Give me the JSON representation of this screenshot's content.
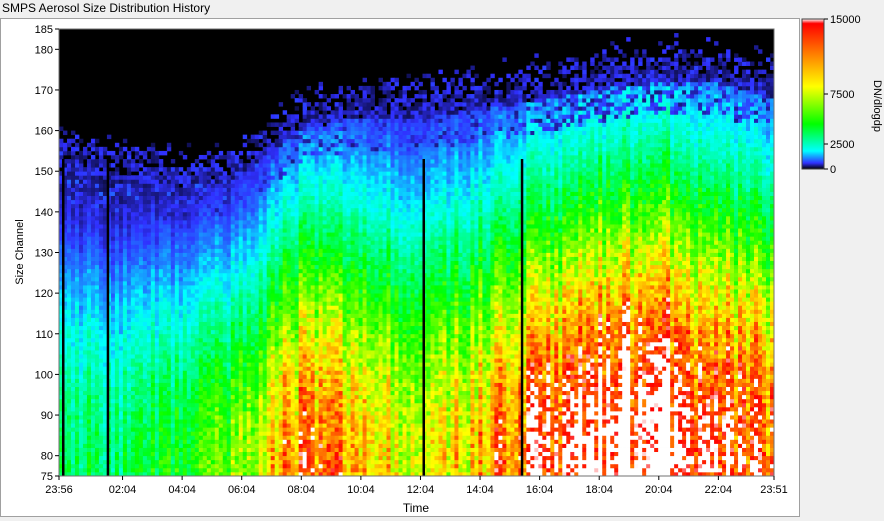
{
  "window": {
    "title": "SMPS Aerosol Size Distribution History"
  },
  "chart_data": {
    "type": "heatmap",
    "title": "",
    "xlabel": "Time",
    "ylabel": "Size Channel",
    "x_ticks": [
      "23:56",
      "02:04",
      "04:04",
      "06:04",
      "08:04",
      "10:04",
      "12:04",
      "14:04",
      "16:04",
      "18:04",
      "20:04",
      "22:04",
      "23:51"
    ],
    "x_range": [
      "23:56",
      "23:51"
    ],
    "y_ticks": [
      75,
      80,
      90,
      100,
      110,
      120,
      130,
      140,
      150,
      160,
      170,
      180,
      185
    ],
    "ylim": [
      75,
      185
    ],
    "colorbar": {
      "label": "DN/dlogdp",
      "ticks": [
        0,
        2500,
        7500,
        15000
      ],
      "range": [
        0,
        15000
      ],
      "colors": [
        "#000000",
        "#3030ff",
        "#00ffff",
        "#00ff00",
        "#ffff00",
        "#ff8800",
        "#ff0000",
        "#ffffff"
      ]
    },
    "gaps_hours": [
      0.1,
      1.6,
      12.2,
      15.5
    ],
    "profile": [
      {
        "hour": 0,
        "peak": 3500,
        "top_channel": 150
      },
      {
        "hour": 2,
        "peak": 3500,
        "top_channel": 148
      },
      {
        "hour": 4,
        "peak": 4500,
        "top_channel": 146
      },
      {
        "hour": 6,
        "peak": 6000,
        "top_channel": 148
      },
      {
        "hour": 8,
        "peak": 12000,
        "top_channel": 160
      },
      {
        "hour": 10,
        "peak": 11000,
        "top_channel": 163
      },
      {
        "hour": 12,
        "peak": 8000,
        "top_channel": 163
      },
      {
        "hour": 14,
        "peak": 10000,
        "top_channel": 165
      },
      {
        "hour": 16,
        "peak": 14000,
        "top_channel": 167
      },
      {
        "hour": 18,
        "peak": 17000,
        "top_channel": 170
      },
      {
        "hour": 20,
        "peak": 19000,
        "top_channel": 172
      },
      {
        "hour": 22,
        "peak": 15000,
        "top_channel": 172
      },
      {
        "hour": 24,
        "peak": 13000,
        "top_channel": 168
      }
    ]
  }
}
